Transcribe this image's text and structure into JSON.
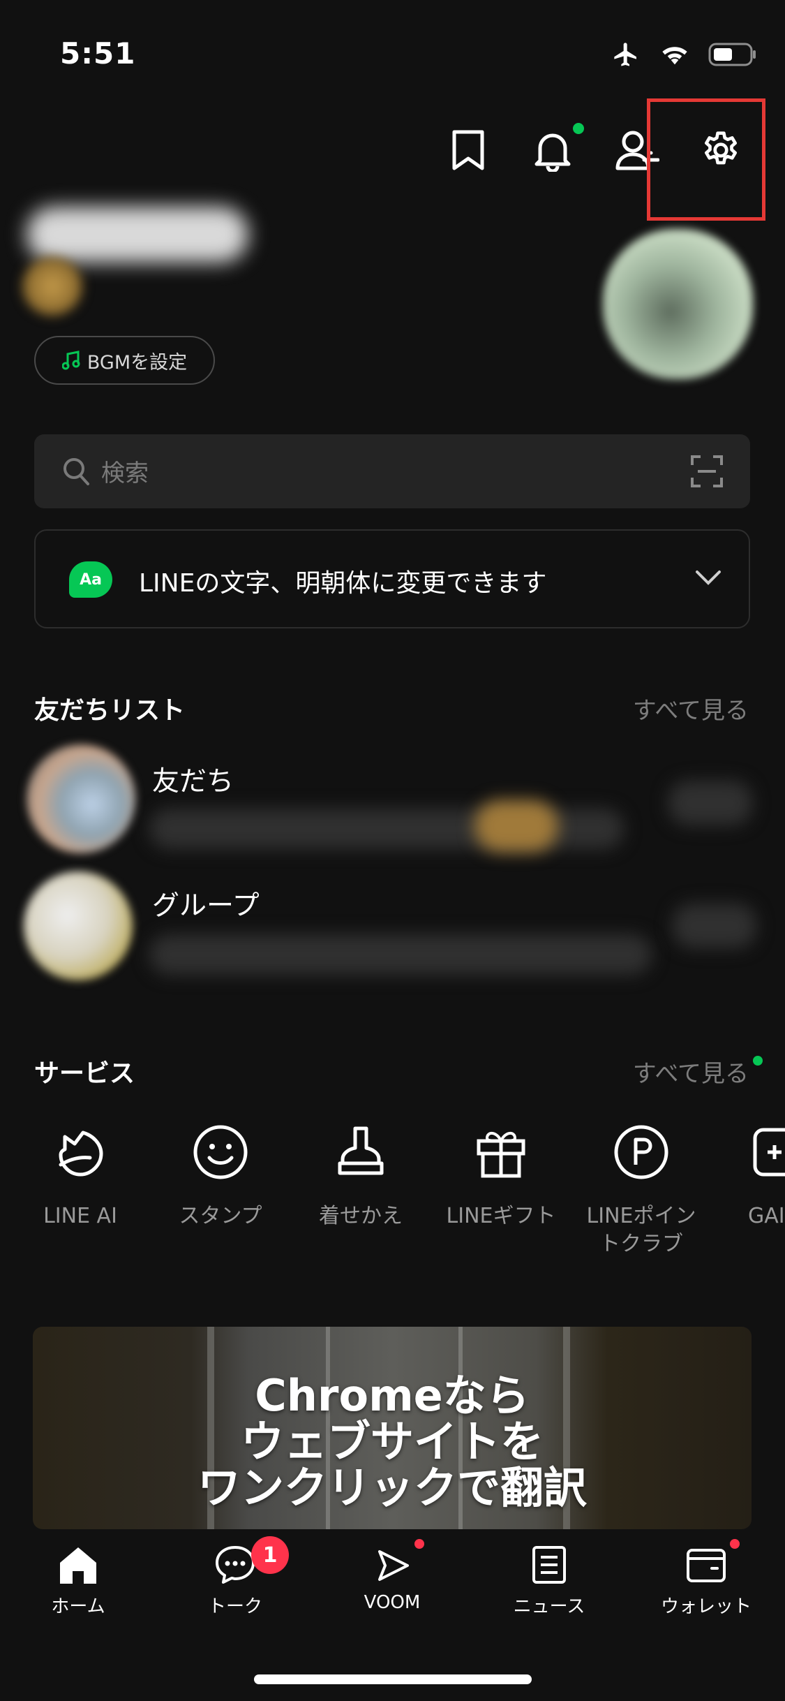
{
  "status_bar": {
    "time": "5:51"
  },
  "header": {
    "icons": [
      "bookmark-icon",
      "bell-icon",
      "add-friend-icon",
      "gear-icon"
    ],
    "accent_green": "#06c755",
    "highlight_color": "#e53935"
  },
  "profile": {
    "bgm_label": "BGMを設定"
  },
  "search": {
    "placeholder": "検索"
  },
  "notice": {
    "badge": "Aa",
    "text": "LINEの文字、明朝体に変更できます"
  },
  "friends_section": {
    "title": "友だちリスト",
    "see_all": "すべて見る",
    "items": [
      {
        "label": "友だち"
      },
      {
        "label": "グループ"
      }
    ]
  },
  "services_section": {
    "title": "サービス",
    "see_all": "すべて見る",
    "items": [
      {
        "label": "LINE AI",
        "icon": "line-ai-icon"
      },
      {
        "label": "スタンプ",
        "icon": "sticker-smiley-icon"
      },
      {
        "label": "着せかえ",
        "icon": "theme-brush-icon"
      },
      {
        "label": "LINEギフト",
        "icon": "gift-icon"
      },
      {
        "label": "LINEポイン\nトクラブ",
        "icon": "points-icon"
      },
      {
        "label": "GAI",
        "icon": "game-icon"
      }
    ]
  },
  "banner": {
    "line1": "Chromeなら",
    "line2": "ウェブサイトを",
    "line3": "ワンクリックで翻訳"
  },
  "tabbar": {
    "tabs": [
      {
        "label": "ホーム",
        "icon": "home-icon"
      },
      {
        "label": "トーク",
        "icon": "chat-icon",
        "badge": "1"
      },
      {
        "label": "VOOM",
        "icon": "voom-icon"
      },
      {
        "label": "ニュース",
        "icon": "news-icon"
      },
      {
        "label": "ウォレット",
        "icon": "wallet-icon"
      }
    ]
  }
}
